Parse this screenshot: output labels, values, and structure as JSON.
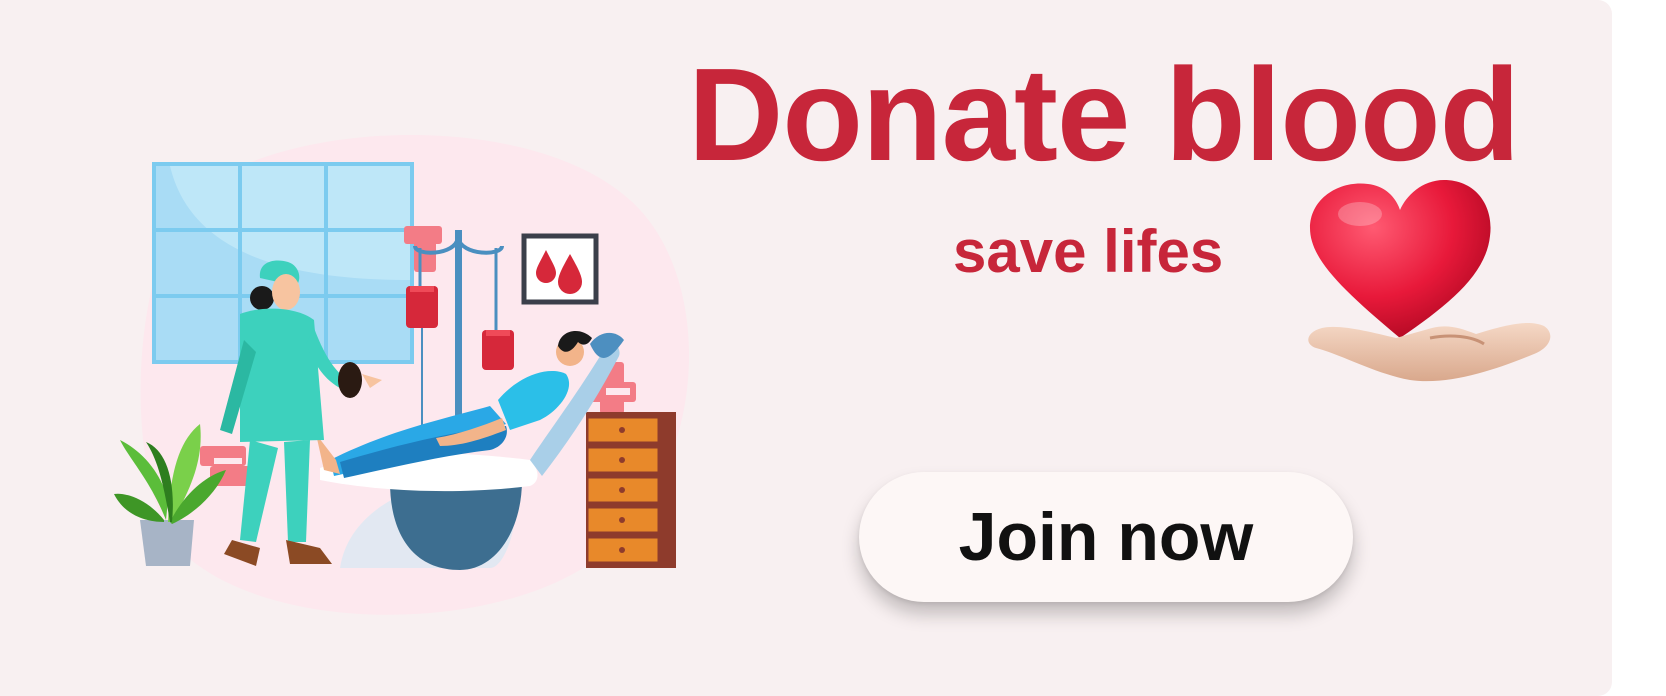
{
  "banner": {
    "headline": "Donate blood",
    "subline": "save lifes",
    "cta_label": "Join now"
  },
  "colors": {
    "accent": "#c7263a",
    "background": "#f8f0f1",
    "button": "#fdf7f6",
    "nurse": "#3dd1bd",
    "window": "#a9dcf5",
    "drawer": "#e8892a",
    "blood": "#d6283a"
  },
  "icons": [
    "heart-in-hand-icon",
    "blood-drops-icon",
    "medical-cross-icon",
    "plant-icon"
  ]
}
